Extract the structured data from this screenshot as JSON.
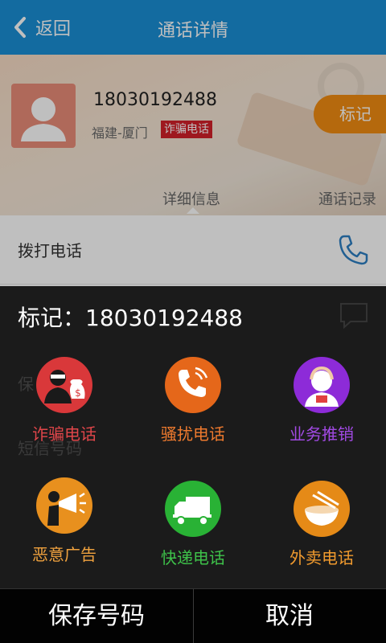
{
  "topbar": {
    "back_label": "返回",
    "title": "通话详情",
    "color": "#1a8fd6"
  },
  "contact": {
    "number": "18030192488",
    "location": "福建-厦门",
    "tag": "诈骗电话",
    "mark_button": "标记"
  },
  "tabs": {
    "detail": "详细信息",
    "log": "通话记录"
  },
  "rows": [
    {
      "label": "拨打电话",
      "icon": "phone-icon"
    }
  ],
  "ghost_labels": [
    "保",
    "短信号码"
  ],
  "dialog": {
    "title": "标记：18030192488",
    "categories": [
      {
        "label": "诈骗电话",
        "icon": "thief-icon",
        "color": "#d9383a"
      },
      {
        "label": "骚扰电话",
        "icon": "ringing-phone-icon",
        "color": "#e5671a"
      },
      {
        "label": "业务推销",
        "icon": "salesperson-icon",
        "color": "#8d2bd8"
      },
      {
        "label": "恶意广告",
        "icon": "megaphone-icon",
        "color": "#e8901e"
      },
      {
        "label": "快递电话",
        "icon": "truck-icon",
        "color": "#29b235"
      },
      {
        "label": "外卖电话",
        "icon": "bowl-icon",
        "color": "#e58a17"
      }
    ],
    "save_button": "保存号码",
    "cancel_button": "取消"
  }
}
